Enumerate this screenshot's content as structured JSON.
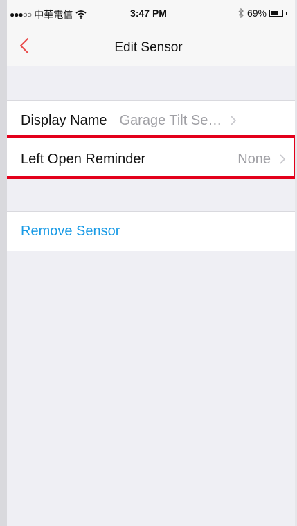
{
  "status_bar": {
    "signal_dots": "●●●○○",
    "carrier": "中華電信",
    "wifi_icon": "wifi-icon",
    "time": "3:47 PM",
    "bluetooth_icon": "bluetooth-icon",
    "battery_percent": "69%",
    "battery_level": 0.69
  },
  "nav": {
    "back_icon": "chevron-left-icon",
    "title": "Edit Sensor",
    "accent_color": "#e94a4a"
  },
  "settings": {
    "display_name": {
      "label": "Display Name",
      "value": "Garage Tilt Se…"
    },
    "left_open_reminder": {
      "label": "Left Open Reminder",
      "value": "None"
    }
  },
  "actions": {
    "remove_sensor": "Remove Sensor",
    "link_color": "#1a9be6"
  },
  "highlight_color": "#e3001b"
}
